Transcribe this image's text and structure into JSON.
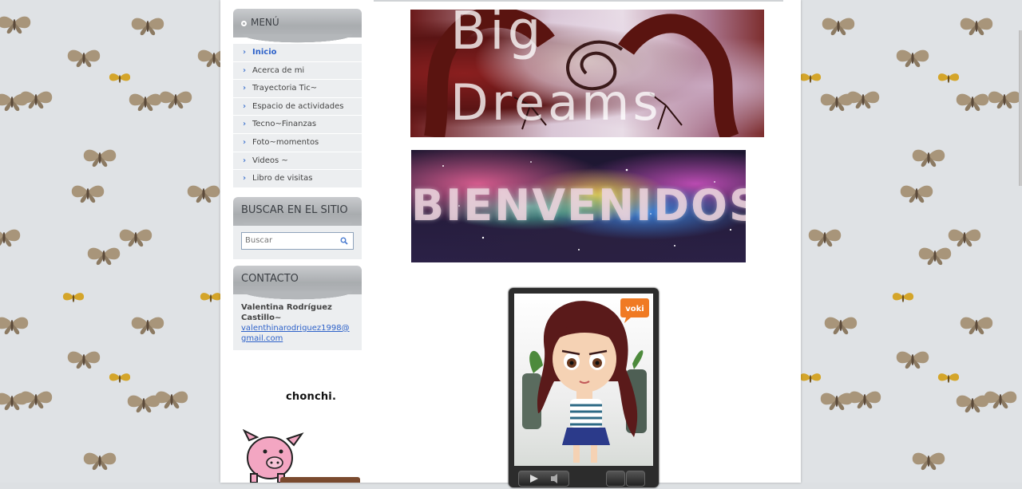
{
  "sidebar": {
    "menu": {
      "title": "MENÚ",
      "items": [
        {
          "label": "Inicio",
          "active": true
        },
        {
          "label": "Acerca de mi"
        },
        {
          "label": "Trayectoria Tic~"
        },
        {
          "label": "Espacio de actividades"
        },
        {
          "label": "Tecno~Finanzas"
        },
        {
          "label": "Foto~momentos"
        },
        {
          "label": "Videos ~"
        },
        {
          "label": "Libro de visitas"
        }
      ]
    },
    "search": {
      "title": "BUSCAR EN EL SITIO",
      "placeholder": "Buscar"
    },
    "contact": {
      "title": "CONTACTO",
      "name": "Valentina Rodríguez Castillo~",
      "email": "valenthinarodriguez1998@gmail.com"
    },
    "widget_caption": "chonchi."
  },
  "main": {
    "banner_top_text": "Big Dreams",
    "banner_welcome_text": "BIENVENIDOS",
    "voki_badge": "voki"
  },
  "colors": {
    "accent_link": "#2e62c9",
    "sidebar_bg": "#eceef0",
    "header_gray": "#b4b7ba"
  }
}
